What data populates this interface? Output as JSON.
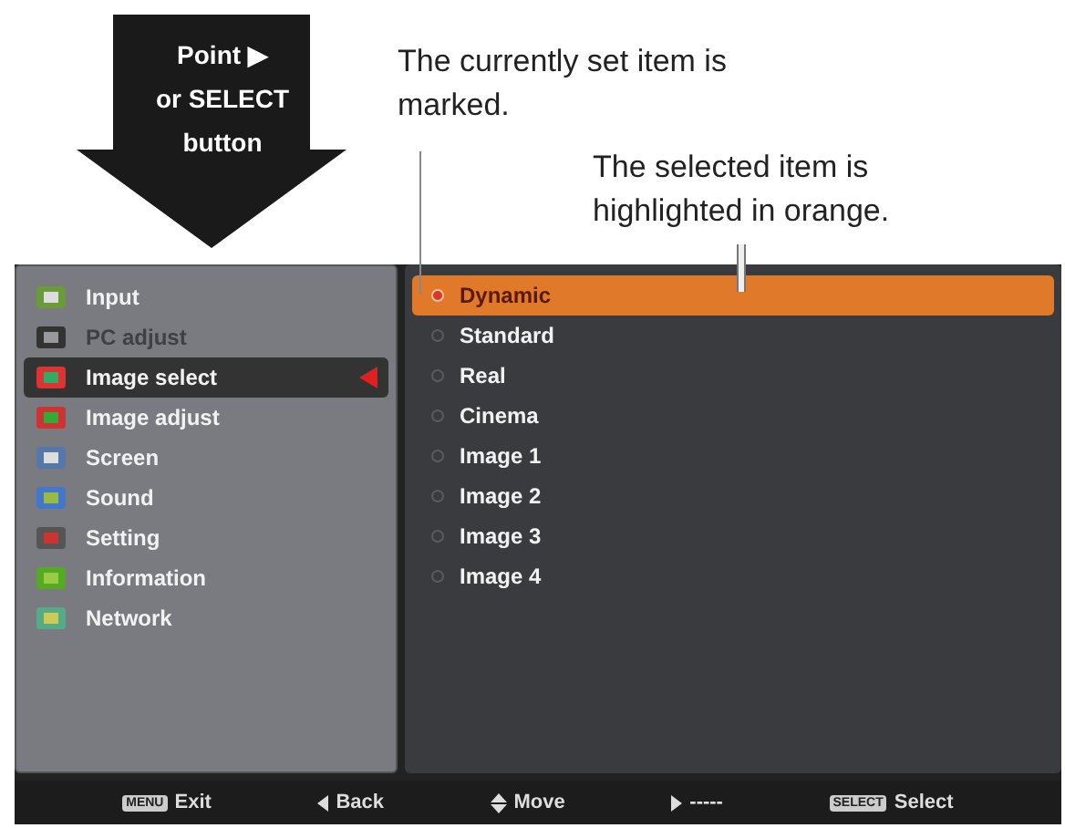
{
  "arrow_label": [
    "Point ▶",
    "or SELECT",
    "button"
  ],
  "notes": [
    {
      "text": "The currently set item is marked."
    },
    {
      "text": "The selected item is highlighted in orange."
    }
  ],
  "menu": [
    {
      "label": "Input",
      "disabled": false,
      "selected": false
    },
    {
      "label": "PC adjust",
      "disabled": true,
      "selected": false
    },
    {
      "label": "Image select",
      "disabled": false,
      "selected": true
    },
    {
      "label": "Image adjust",
      "disabled": false,
      "selected": false
    },
    {
      "label": "Screen",
      "disabled": false,
      "selected": false
    },
    {
      "label": "Sound",
      "disabled": false,
      "selected": false
    },
    {
      "label": "Setting",
      "disabled": false,
      "selected": false
    },
    {
      "label": "Information",
      "disabled": false,
      "selected": false
    },
    {
      "label": "Network",
      "disabled": false,
      "selected": false
    }
  ],
  "options": [
    {
      "label": "Dynamic",
      "marked": true,
      "selected": true
    },
    {
      "label": "Standard",
      "marked": false,
      "selected": false
    },
    {
      "label": "Real",
      "marked": false,
      "selected": false
    },
    {
      "label": "Cinema",
      "marked": false,
      "selected": false
    },
    {
      "label": "Image 1",
      "marked": false,
      "selected": false
    },
    {
      "label": "Image 2",
      "marked": false,
      "selected": false
    },
    {
      "label": "Image 3",
      "marked": false,
      "selected": false
    },
    {
      "label": "Image 4",
      "marked": false,
      "selected": false
    }
  ],
  "hints": [
    {
      "kind": "key",
      "key": "MENU",
      "label": "Exit"
    },
    {
      "kind": "left",
      "label": "Back"
    },
    {
      "kind": "updown",
      "label": "Move"
    },
    {
      "kind": "right",
      "label": "-----"
    },
    {
      "kind": "key",
      "key": "SELECT",
      "label": "Select"
    }
  ]
}
